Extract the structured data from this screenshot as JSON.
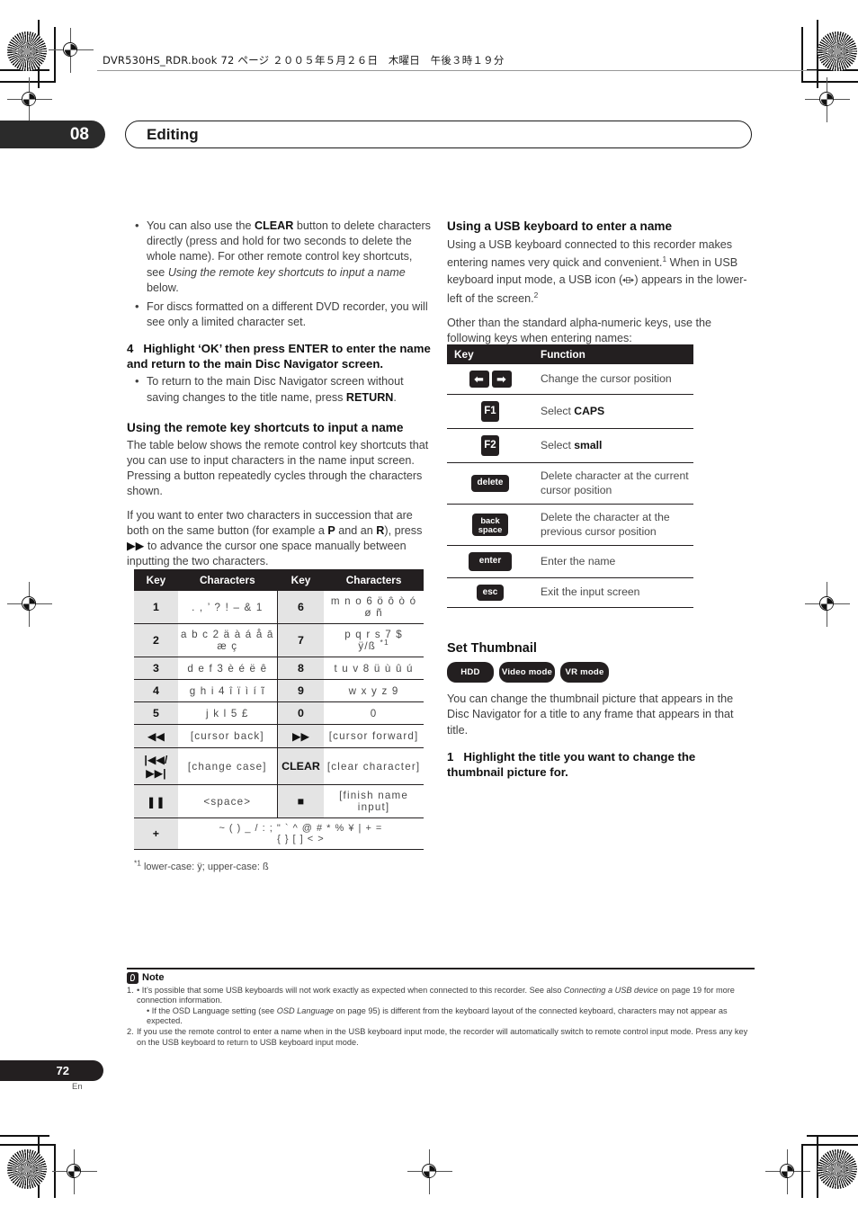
{
  "book_header": "DVR530HS_RDR.book  72 ページ  ２００５年５月２６日　木曜日　午後３時１９分",
  "chapter": {
    "number": "08",
    "title": "Editing"
  },
  "page_footer": {
    "number": "72",
    "lang": "En"
  },
  "left_column": {
    "bullets_top": [
      "You can also use the CLEAR button to delete characters directly (press and hold for two seconds to delete the whole name). For other remote control key shortcuts, see Using the remote key shortcuts to input a name below.",
      "For discs formatted on a different DVD recorder, you will see only a limited character set."
    ],
    "step4": {
      "number": "4",
      "text": "Highlight ‘OK’ then press ENTER to enter the name and return to the main Disc Navigator screen."
    },
    "step4_bullet": "To return to the main Disc Navigator screen without saving changes to the title name, press RETURN.",
    "section_heading": "Using the remote key shortcuts to input a name",
    "para1": "The table below shows the remote control key shortcuts that you can use to input characters in the name input screen. Pressing a button repeatedly cycles through the characters shown.",
    "para2": "If you want to enter two characters in succession that are both on the same button (for example a P and an R), press ▶▶ to advance the cursor one space manually between inputting the two characters.",
    "char_table": {
      "headers": [
        "Key",
        "Characters",
        "Key",
        "Characters"
      ],
      "rows": [
        {
          "k1": "1",
          "c1": ". , ’ ? ! – & 1",
          "k2": "6",
          "c2": "m n o 6 ö ô ò ó ø ñ"
        },
        {
          "k1": "2",
          "c1": "a b c 2 ä à á å ā\næ ç",
          "k2": "7",
          "c2": "p q r s 7 $\nÿ/ß *1"
        },
        {
          "k1": "3",
          "c1": "d e f 3 è é ë ê",
          "k2": "8",
          "c2": "t u v 8 ü ù û ú"
        },
        {
          "k1": "4",
          "c1": "g h i 4 î ï ì í ĩ",
          "k2": "9",
          "c2": "w x y z 9"
        },
        {
          "k1": "5",
          "c1": "j k l 5 £",
          "k2": "0",
          "c2": "0"
        },
        {
          "k1": "◀◀",
          "c1": "[cursor back]",
          "k2": "▶▶",
          "c2": "[cursor forward]"
        },
        {
          "k1": "|◀◀/\n▶▶|",
          "c1": "[change case]",
          "k2": "CLEAR",
          "c2": "[clear character]"
        },
        {
          "k1": "❚❚",
          "c1": "<space>",
          "k2": "■",
          "c2": "[finish name input]"
        }
      ],
      "last_row": {
        "key": "+",
        "chars": "~ ( ) _ / : ; \" ` ^ @ # * % ¥ | + =\n{ } [ ] < >"
      }
    },
    "footnote": "*1 lower-case: ÿ; upper-case: ß"
  },
  "right_column": {
    "section_heading": "Using a USB keyboard to enter a name",
    "para1": "Using a USB keyboard connected to this recorder makes entering names very quick and convenient.1 When in USB keyboard input mode, a USB icon (⇔) appears in the lower-left of the screen.2",
    "para2": "Other than the standard alpha-numeric keys, use the following keys when entering names:",
    "usb_table": {
      "headers": [
        "Key",
        "Function"
      ],
      "rows": [
        {
          "key": "← →",
          "key_type": "arrows",
          "function": "Change the cursor position"
        },
        {
          "key": "F1",
          "key_type": "square",
          "function": "Select CAPS"
        },
        {
          "key": "F2",
          "key_type": "square",
          "function": "Select small"
        },
        {
          "key": "delete",
          "key_type": "wide",
          "function": "Delete character at the current cursor position"
        },
        {
          "key": "back space",
          "key_type": "twoline",
          "function": "Delete the character at the previous cursor position"
        },
        {
          "key": "enter",
          "key_type": "wide",
          "function": "Enter the name"
        },
        {
          "key": "esc",
          "key_type": "small",
          "function": "Exit the input screen"
        }
      ]
    },
    "set_thumbnail": {
      "heading": "Set Thumbnail",
      "badges": [
        "HDD",
        "Video mode",
        "VR mode"
      ],
      "para": "You can change the thumbnail picture that appears in the Disc Navigator for a title to any frame that appears in that title.",
      "step1": {
        "number": "1",
        "text": "Highlight the title you want to change the thumbnail picture for."
      }
    }
  },
  "notes": {
    "label": "Note",
    "items": [
      {
        "num": "1.",
        "bullet": "•",
        "text": "It’s possible that some USB keyboards will not work exactly as expected when connected to this recorder. See also Connecting a USB device on page 19 for more connection information."
      },
      {
        "num": "",
        "bullet": "•",
        "text": "If the OSD Language setting (see OSD Language on page 95) is different from the keyboard layout of the connected keyboard, characters may not appear as expected."
      },
      {
        "num": "2.",
        "bullet": "",
        "text": "If you use the remote control to enter a name when in the USB keyboard input mode, the recorder will automatically switch to remote control input mode. Press any key on the USB keyboard to return to USB keyboard input mode."
      }
    ]
  },
  "colors": {
    "ink": "#231f20",
    "body": "#3f3f3f",
    "key_cell_bg": "#e4e4e4"
  }
}
